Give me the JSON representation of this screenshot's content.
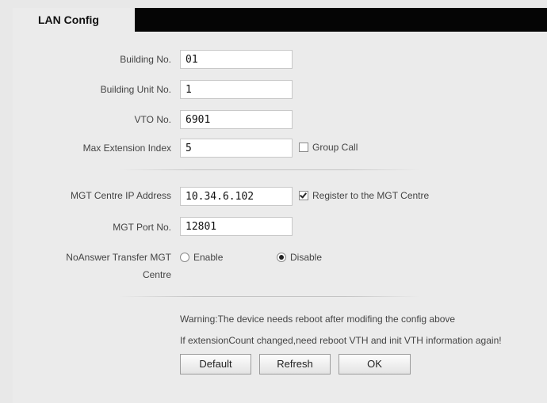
{
  "tab": {
    "title": "LAN Config"
  },
  "form": {
    "building_no": {
      "label": "Building No.",
      "value": "01"
    },
    "building_unit_no": {
      "label": "Building Unit No.",
      "value": "1"
    },
    "vto_no": {
      "label": "VTO No.",
      "value": "6901"
    },
    "max_extension_index": {
      "label": "Max Extension Index",
      "value": "5"
    },
    "group_call": {
      "label": "Group Call",
      "checked": false
    },
    "mgt_ip": {
      "label": "MGT Centre IP Address",
      "value": "10.34.6.102"
    },
    "register_mgt": {
      "label": "Register to the MGT Centre",
      "checked": true
    },
    "mgt_port": {
      "label": "MGT Port No.",
      "value": "12801"
    },
    "noanswer": {
      "label_line1": "NoAnswer Transfer MGT",
      "label_line2": "Centre",
      "enable_label": "Enable",
      "disable_label": "Disable",
      "selected": "Disable"
    }
  },
  "warnings": {
    "line1": "Warning:The device needs reboot after modifing the config above",
    "line2": "If extensionCount changed,need reboot VTH and init VTH information again!"
  },
  "buttons": {
    "default": "Default",
    "refresh": "Refresh",
    "ok": "OK"
  }
}
